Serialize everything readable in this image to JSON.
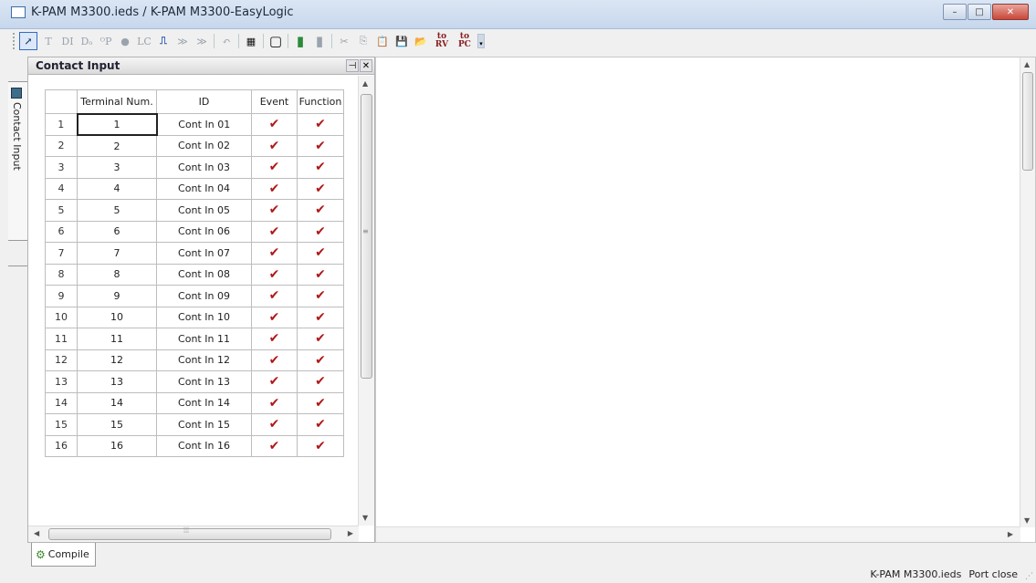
{
  "window": {
    "title": "K-PAM M3300.ieds / K-PAM M3300-EasyLogic",
    "minimize": "–",
    "maximize": "□",
    "close": "✕"
  },
  "toolbar": {
    "items": [
      {
        "name": "select-tool",
        "glyph": "↗"
      },
      {
        "name": "text-tool",
        "glyph": "T"
      },
      {
        "name": "digital-input-tool",
        "glyph": "DI"
      },
      {
        "name": "digital-output-tool",
        "glyph": "Dₒ"
      },
      {
        "name": "output-point-tool",
        "glyph": "ᴼP"
      },
      {
        "name": "led-tool",
        "glyph": "●"
      },
      {
        "name": "logic-component-tool",
        "glyph": "LC"
      },
      {
        "name": "pulse-tool",
        "glyph": "⎍"
      },
      {
        "name": "forward-tool",
        "glyph": "≫"
      },
      {
        "name": "forward2-tool",
        "glyph": "≫"
      },
      {
        "name": "undo-tool",
        "glyph": "↶"
      },
      {
        "name": "grid-tool",
        "glyph": "▦"
      },
      {
        "name": "frame-tool",
        "glyph": "▢"
      },
      {
        "name": "color-tool",
        "glyph": "▮"
      },
      {
        "name": "fill-tool",
        "glyph": "▮"
      },
      {
        "name": "cut-tool",
        "glyph": "✂"
      },
      {
        "name": "copy-tool",
        "glyph": "⎘"
      },
      {
        "name": "paste-tool",
        "glyph": "📋"
      },
      {
        "name": "save-tool",
        "glyph": "💾"
      },
      {
        "name": "open-tool",
        "glyph": "📂"
      }
    ],
    "to_rv_label": "to RV",
    "to_pc_label": "to PC",
    "more": "▾"
  },
  "side_tab": {
    "label": "Contact Input"
  },
  "panel": {
    "title": "Contact Input",
    "pin": "⊣",
    "close": "✕",
    "columns": [
      "",
      "Terminal Num.",
      "ID",
      "Event",
      "Function"
    ],
    "rows": [
      {
        "num": "1",
        "terminal": "1",
        "id": "Cont In 01",
        "event": "✔",
        "function": "✔"
      },
      {
        "num": "2",
        "terminal": "2",
        "id": "Cont In 02",
        "event": "✔",
        "function": "✔"
      },
      {
        "num": "3",
        "terminal": "3",
        "id": "Cont In 03",
        "event": "✔",
        "function": "✔"
      },
      {
        "num": "4",
        "terminal": "4",
        "id": "Cont In 04",
        "event": "✔",
        "function": "✔"
      },
      {
        "num": "5",
        "terminal": "5",
        "id": "Cont In 05",
        "event": "✔",
        "function": "✔"
      },
      {
        "num": "6",
        "terminal": "6",
        "id": "Cont In 06",
        "event": "✔",
        "function": "✔"
      },
      {
        "num": "7",
        "terminal": "7",
        "id": "Cont In 07",
        "event": "✔",
        "function": "✔"
      },
      {
        "num": "8",
        "terminal": "8",
        "id": "Cont In 08",
        "event": "✔",
        "function": "✔"
      },
      {
        "num": "9",
        "terminal": "9",
        "id": "Cont In 09",
        "event": "✔",
        "function": "✔"
      },
      {
        "num": "10",
        "terminal": "10",
        "id": "Cont In 10",
        "event": "✔",
        "function": "✔"
      },
      {
        "num": "11",
        "terminal": "11",
        "id": "Cont In 11",
        "event": "✔",
        "function": "✔"
      },
      {
        "num": "12",
        "terminal": "12",
        "id": "Cont In 12",
        "event": "✔",
        "function": "✔"
      },
      {
        "num": "13",
        "terminal": "13",
        "id": "Cont In 13",
        "event": "✔",
        "function": "✔"
      },
      {
        "num": "14",
        "terminal": "14",
        "id": "Cont In 14",
        "event": "✔",
        "function": "✔"
      },
      {
        "num": "15",
        "terminal": "15",
        "id": "Cont In 15",
        "event": "✔",
        "function": "✔"
      },
      {
        "num": "16",
        "terminal": "16",
        "id": "Cont In 16",
        "event": "✔",
        "function": "✔"
      }
    ]
  },
  "bottom_tab": {
    "label": "Compile"
  },
  "status": {
    "file": "K-PAM M3300.ieds",
    "port": "Port close"
  },
  "colors": {
    "check": "#b01818",
    "title_bar": "#c7d7ec",
    "close_button": "#c9473a"
  }
}
